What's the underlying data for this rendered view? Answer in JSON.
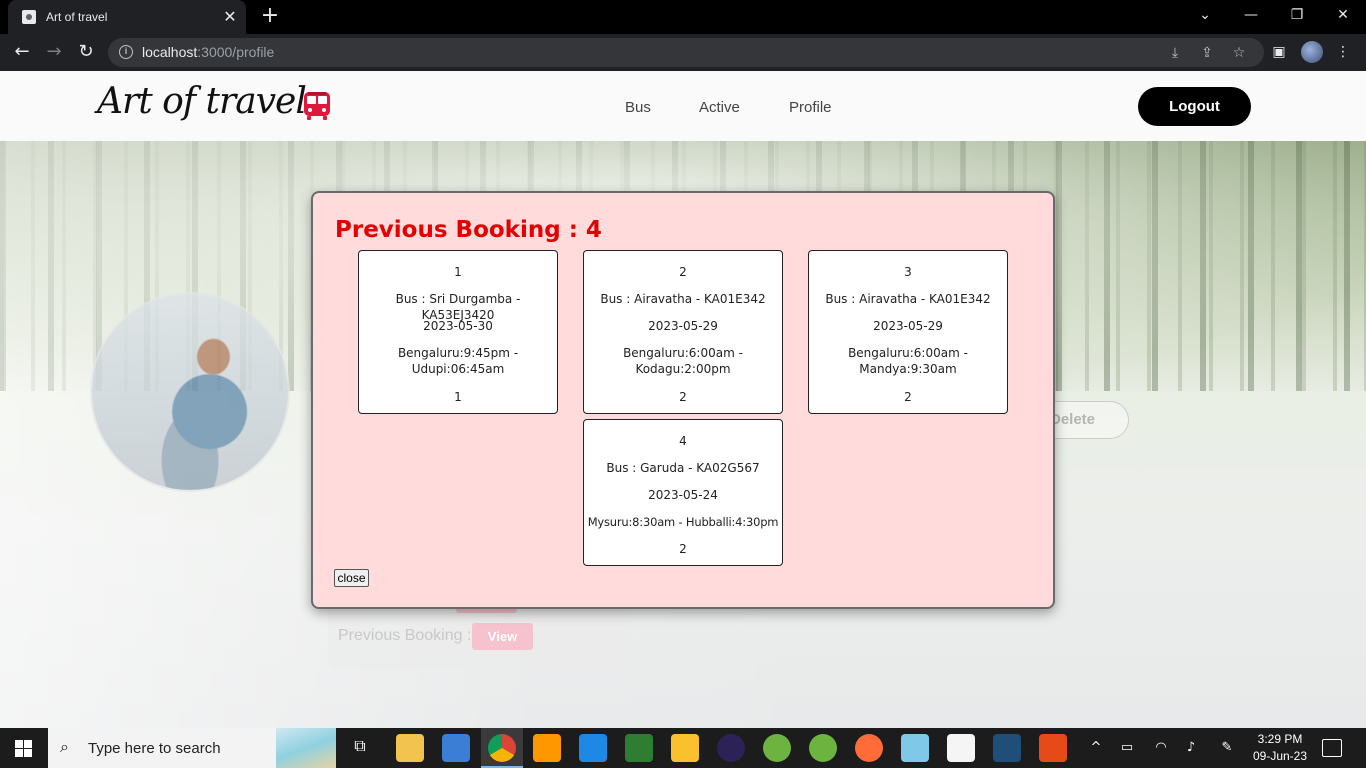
{
  "browser": {
    "tab_title": "Art of travel",
    "tab_close": "✕",
    "new_tab": "+",
    "url_host": "localhost",
    "url_rest": ":3000/profile"
  },
  "navbar": {
    "brand": "Art of travel",
    "links": [
      "Bus",
      "Active",
      "Profile"
    ],
    "logout_label": "Logout"
  },
  "profile": {
    "delete_label": "Delete",
    "previous_booking_label": "Previous Booking :",
    "view_label": "View"
  },
  "modal": {
    "title": "Previous Booking : 4",
    "close_label": "close",
    "bookings": [
      {
        "index": "1",
        "bus": "Bus : Sri Durgamba - KA53EJ3420",
        "date": "2023-05-30",
        "route": "Bengaluru:9:45pm - Udupi:06:45am",
        "seats": "1"
      },
      {
        "index": "2",
        "bus": "Bus : Airavatha - KA01E342",
        "date": "2023-05-29",
        "route": "Bengaluru:6:00am - Kodagu:2:00pm",
        "seats": "2"
      },
      {
        "index": "3",
        "bus": "Bus : Airavatha - KA01E342",
        "date": "2023-05-29",
        "route": "Bengaluru:6:00am - Mandya:9:30am",
        "seats": "2"
      },
      {
        "index": "4",
        "bus": "Bus : Garuda - KA02G567",
        "date": "2023-05-24",
        "route": "Mysuru:8:30am - Hubballi:4:30pm",
        "seats": "2"
      }
    ]
  },
  "taskbar": {
    "search_placeholder": "Type here to search",
    "time": "3:29 PM",
    "date": "09-Jun-23"
  },
  "colors": {
    "modal_bg": "#ffdbdb",
    "title_red": "#e20000",
    "view_pink": "#f6c2cd"
  }
}
